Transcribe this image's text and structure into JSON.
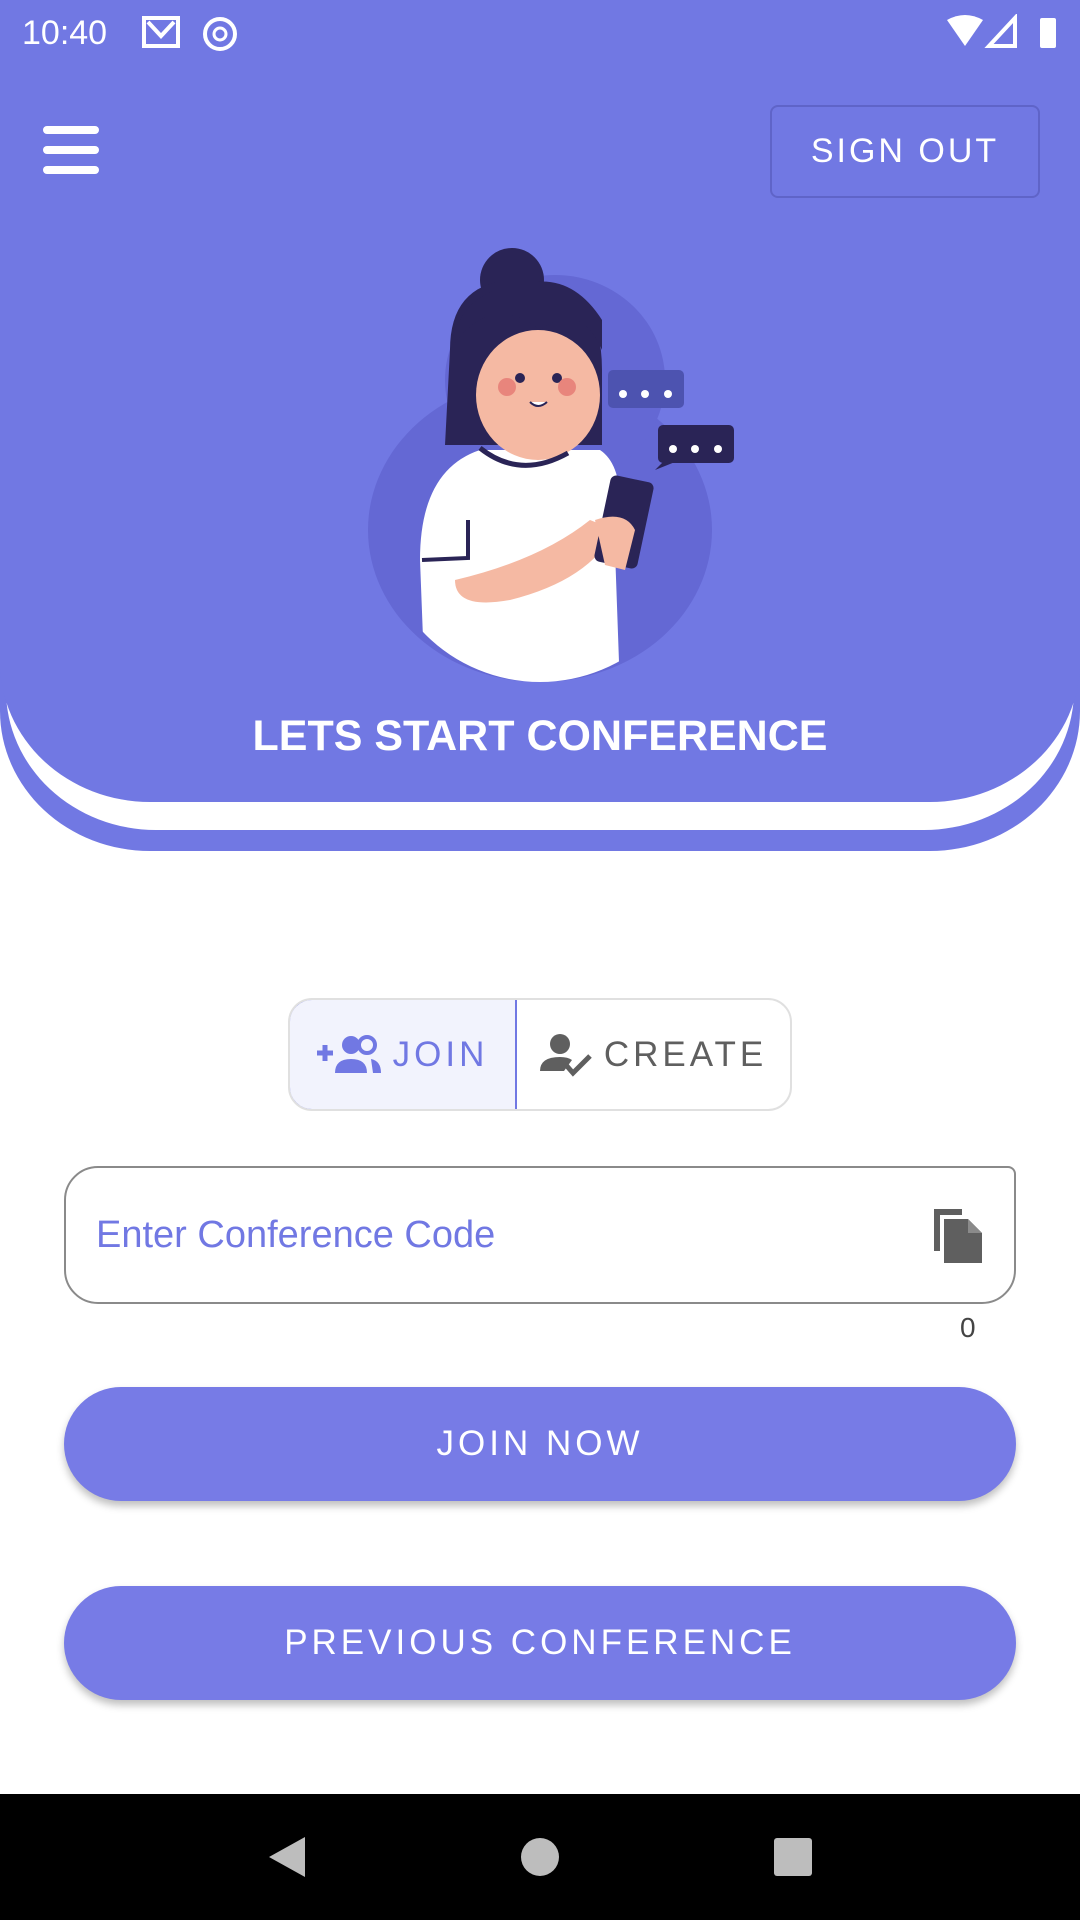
{
  "status_bar": {
    "time": "10:40",
    "left_icons": [
      "gmail-icon",
      "at-sign-icon"
    ],
    "right_icons": [
      "wifi-icon",
      "signal-icon",
      "battery-icon"
    ]
  },
  "header": {
    "menu_icon": "hamburger-menu-icon",
    "sign_out_label": "SIGN OUT",
    "title": "LETS START CONFERENCE"
  },
  "toggle": {
    "join_label": "JOIN",
    "join_icon": "group-add-icon",
    "create_label": "CREATE",
    "create_icon": "person-check-icon",
    "selected": "JOIN"
  },
  "code_input": {
    "placeholder": "Enter Conference Code",
    "value": "",
    "trailing_icon": "paste-icon",
    "counter": "0"
  },
  "buttons": {
    "join_now": "JOIN NOW",
    "previous": "PREVIOUS CONFERENCE"
  },
  "colors": {
    "primary": "#7178e3",
    "button": "#777be6"
  }
}
